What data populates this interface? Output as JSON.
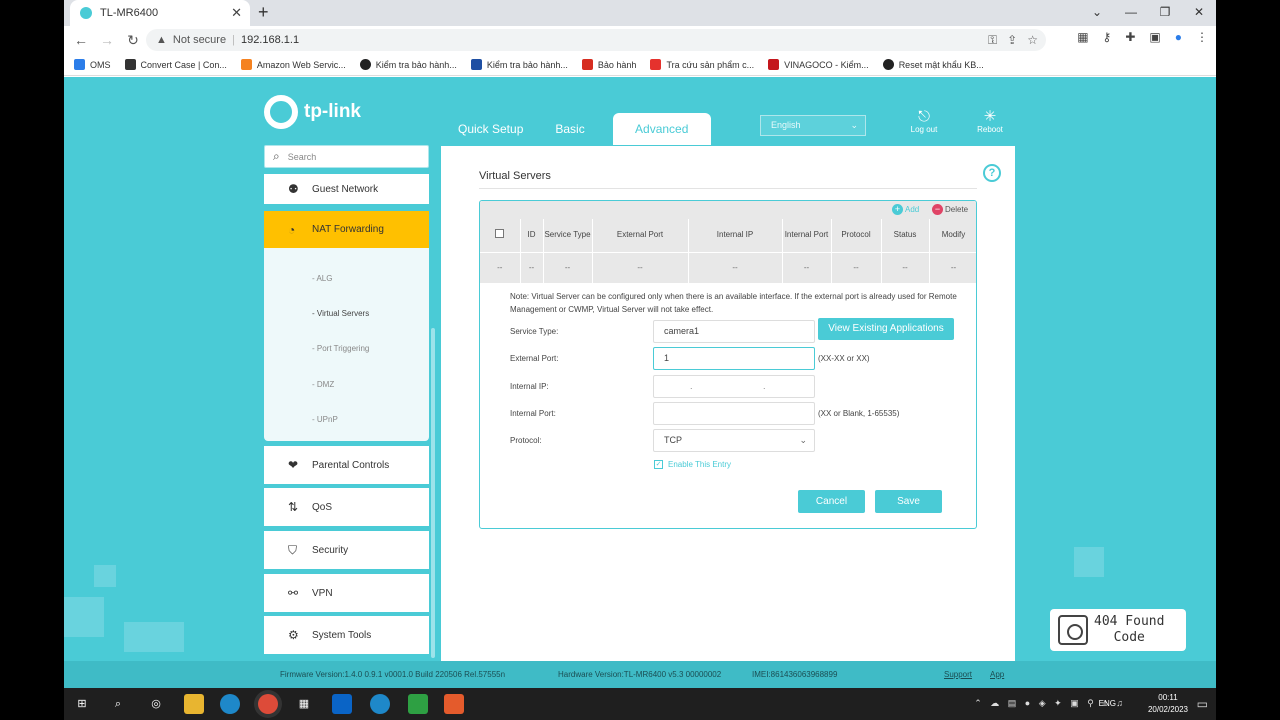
{
  "browser": {
    "tab_title": "TL-MR6400",
    "security": "Not secure",
    "url": "192.168.1.1",
    "bookmarks": [
      {
        "label": "OMS",
        "color": "#2b7de9"
      },
      {
        "label": "Convert Case | Con...",
        "color": "#333333"
      },
      {
        "label": "Amazon Web Servic...",
        "color": "#f58220"
      },
      {
        "label": "Kiểm tra bảo hành...",
        "color": "#222222"
      },
      {
        "label": "Kiểm tra bảo hành...",
        "color": "#1e4fa3"
      },
      {
        "label": "Bảo hành",
        "color": "#d62d20"
      },
      {
        "label": "Tra cứu sản phẩm c...",
        "color": "#e5322d"
      },
      {
        "label": "VINAGOCO - Kiểm...",
        "color": "#c4161c"
      },
      {
        "label": "Reset mật khẩu KB...",
        "color": "#222222"
      }
    ]
  },
  "router": {
    "brand": "tp-link",
    "nav": {
      "quick_setup": "Quick Setup",
      "basic": "Basic",
      "advanced": "Advanced"
    },
    "language": "English",
    "logout": "Log out",
    "reboot": "Reboot",
    "search_placeholder": "Search",
    "sidebar": {
      "guest_network": "Guest Network",
      "nat_forwarding": "NAT Forwarding",
      "sub": [
        "- ALG",
        "- Virtual Servers",
        "- Port Triggering",
        "- DMZ",
        "- UPnP"
      ],
      "parental_controls": "Parental Controls",
      "qos": "QoS",
      "security": "Security",
      "vpn": "VPN",
      "system_tools": "System Tools"
    },
    "content": {
      "title": "Virtual Servers",
      "help": "?",
      "add": "Add",
      "delete": "Delete",
      "columns": [
        "ID",
        "Service Type",
        "External Port",
        "Internal IP",
        "Internal Port",
        "Protocol",
        "Status",
        "Modify"
      ],
      "empty_row": [
        "--",
        "--",
        "--",
        "--",
        "--",
        "--",
        "--",
        "--",
        "--"
      ],
      "note": "Note: Virtual Server can be configured only when there is an available interface. If the external port is already used for Remote Management or CWMP, Virtual Server will not take effect.",
      "service_type_label": "Service Type:",
      "service_type_value": "camera1",
      "view_apps": "View Existing Applications",
      "external_port_label": "External Port:",
      "external_port_value": "1",
      "external_port_hint": "(XX-XX or XX)",
      "internal_ip_label": "Internal IP:",
      "internal_ip_value": ". . .",
      "internal_port_label": "Internal Port:",
      "internal_port_value": "",
      "internal_port_hint": "(XX or Blank, 1-65535)",
      "protocol_label": "Protocol:",
      "protocol_value": "TCP",
      "enable_entry": "Enable This Entry",
      "cancel": "Cancel",
      "save": "Save"
    },
    "footer": {
      "firmware": "Firmware Version:1.4.0 0.9.1 v0001.0 Build 220506 Rel.57555n",
      "hardware": "Hardware Version:TL-MR6400 v5.3 00000002",
      "imei": "IMEI:861436063968899",
      "support": "Support",
      "app": "App"
    }
  },
  "watermark": {
    "line1": "404 Found",
    "line2": "Code"
  },
  "taskbar": {
    "language": "ENG",
    "time": "00:11",
    "date": "20/02/2023"
  }
}
